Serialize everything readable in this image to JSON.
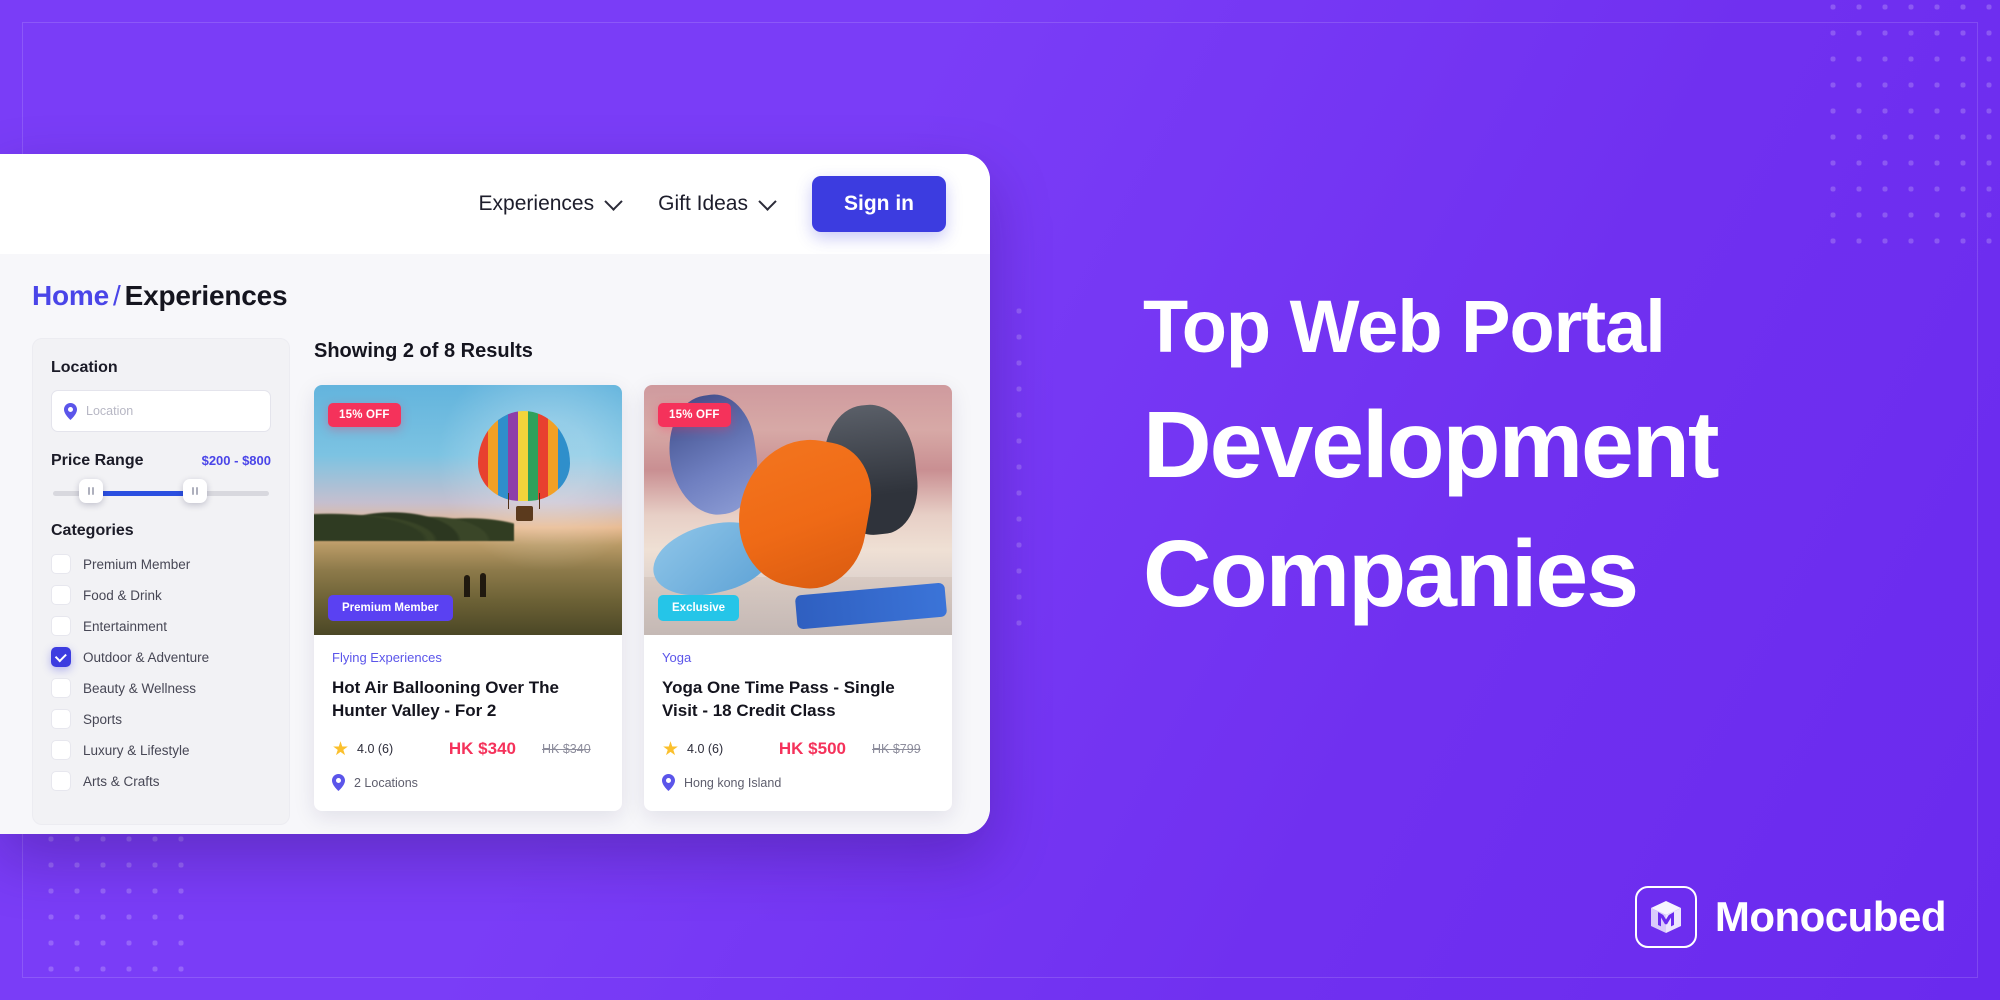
{
  "background": {
    "brand_purple": "#7436f5",
    "accent_blue": "#3c3ce0",
    "accent_pink": "#f5325b"
  },
  "navbar": {
    "items": [
      {
        "label": "Experiences",
        "icon": "chevron-down-icon"
      },
      {
        "label": "Gift Ideas",
        "icon": "chevron-down-icon"
      }
    ],
    "signin_label": "Sign in"
  },
  "breadcrumb": {
    "home": "Home",
    "separator": "/",
    "current": "Experiences"
  },
  "sidebar": {
    "location": {
      "label": "Location",
      "placeholder": "Location",
      "icon": "map-pin-icon"
    },
    "price": {
      "label": "Price Range",
      "value": "$200 - $800"
    },
    "categories": {
      "label": "Categories",
      "items": [
        {
          "label": "Premium Member",
          "checked": false
        },
        {
          "label": "Food & Drink",
          "checked": false
        },
        {
          "label": "Entertainment",
          "checked": false
        },
        {
          "label": "Outdoor & Adventure",
          "checked": true
        },
        {
          "label": "Beauty & Wellness",
          "checked": false
        },
        {
          "label": "Sports",
          "checked": false
        },
        {
          "label": "Luxury & Lifestyle",
          "checked": false
        },
        {
          "label": "Arts & Crafts",
          "checked": false
        }
      ]
    }
  },
  "results": {
    "heading": "Showing 2 of 8 Results",
    "cards": [
      {
        "discount_badge": "15% OFF",
        "image_badge": "Premium Member",
        "category": "Flying Experiences",
        "title": "Hot Air Ballooning Over The Hunter Valley - For 2",
        "rating": "4.0 (6)",
        "price_new": "HK $340",
        "price_old": "HK $340",
        "location": "2 Locations"
      },
      {
        "discount_badge": "15% OFF",
        "image_badge": "Exclusive",
        "category": "Yoga",
        "title": "Yoga One Time Pass - Single Visit - 18 Credit Class",
        "rating": "4.0 (6)",
        "price_new": "HK $500",
        "price_old": "HK $799",
        "location": "Hong kong Island"
      }
    ]
  },
  "promo": {
    "line1": "Top Web Portal",
    "line2": "Development",
    "line3": "Companies"
  },
  "logo": {
    "text": "Monocubed",
    "mark": "monocubed-cube-icon"
  }
}
